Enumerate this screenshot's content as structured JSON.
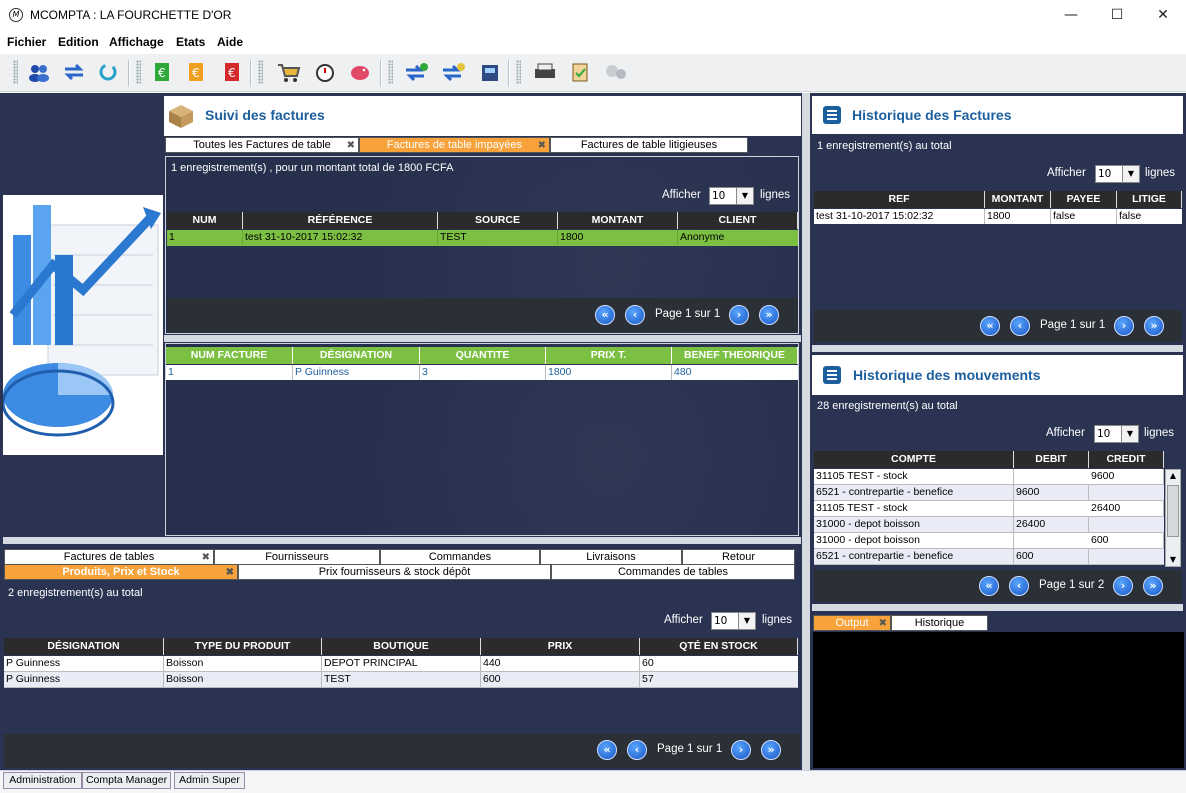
{
  "window": {
    "title": "MCOMPTA : LA FOURCHETTE D'OR",
    "min": "—",
    "max": "☐",
    "close": "✕"
  },
  "menu": [
    "Fichier",
    "Edition",
    "Affichage",
    "Etats",
    "Aide"
  ],
  "suivi": {
    "title": "Suivi des factures",
    "tabs": [
      "Toutes les Factures de table",
      "Factures de table impayées",
      "Factures de table litigieuses"
    ],
    "summary": "1 enregistrement(s) , pour un montant total de 1800 FCFA",
    "afficher": "Afficher",
    "afficher_value": "10",
    "lignes": "lignes",
    "columns": [
      "NUM",
      "RÉFÉRENCE",
      "SOURCE",
      "MONTANT",
      "CLIENT"
    ],
    "rows": [
      [
        "1",
        "test 31-10-2017 15:02:32",
        "TEST",
        "1800",
        "Anonyme"
      ]
    ],
    "page": "Page 1 sur 1"
  },
  "detail": {
    "columns": [
      "NUM FACTURE",
      "DÉSIGNATION",
      "QUANTITE",
      "PRIX T.",
      "BENEF THEORIQUE"
    ],
    "rows": [
      [
        "1",
        "P Guinness",
        "3",
        "1800",
        "480"
      ]
    ]
  },
  "bottom": {
    "tabs_row1": [
      "Factures de tables",
      "Fournisseurs",
      "Commandes",
      "Livraisons",
      "Retour"
    ],
    "tabs_row2": [
      "Produits, Prix et Stock",
      "Prix fournisseurs & stock dépôt",
      "Commandes de tables"
    ],
    "summary": "2 enregistrement(s) au total",
    "afficher": "Afficher",
    "afficher_value": "10",
    "lignes": "lignes",
    "columns": [
      "DÉSIGNATION",
      "TYPE DU PRODUIT",
      "BOUTIQUE",
      "PRIX",
      "QTÉ EN STOCK"
    ],
    "rows": [
      [
        "P Guinness",
        "Boisson",
        "DEPOT PRINCIPAL",
        "440",
        "60"
      ],
      [
        "P Guinness",
        "Boisson",
        "TEST",
        "600",
        "57"
      ]
    ],
    "page": "Page 1 sur 1"
  },
  "historique_factures": {
    "title": "Historique des Factures",
    "summary": "1 enregistrement(s) au total",
    "afficher": "Afficher",
    "afficher_value": "10",
    "lignes": "lignes",
    "columns": [
      "REF",
      "MONTANT",
      "PAYEE",
      "LITIGE"
    ],
    "rows": [
      [
        "test 31-10-2017 15:02:32",
        "1800",
        "false",
        "false"
      ]
    ],
    "page": "Page 1 sur 1"
  },
  "historique_mouvements": {
    "title": "Historique des mouvements",
    "summary": "28 enregistrement(s) au total",
    "afficher": "Afficher",
    "afficher_value": "10",
    "lignes": "lignes",
    "columns": [
      "COMPTE",
      "DEBIT",
      "CREDIT"
    ],
    "rows": [
      [
        "31105 TEST - stock",
        "",
        "9600"
      ],
      [
        "6521 - contrepartie - benefice",
        "9600",
        ""
      ],
      [
        "31105 TEST - stock",
        "",
        "26400"
      ],
      [
        "31000 - depot boisson",
        "26400",
        ""
      ],
      [
        "31000 - depot boisson",
        "",
        "600"
      ],
      [
        "6521 - contrepartie - benefice",
        "600",
        ""
      ]
    ],
    "page": "Page 1 sur 2"
  },
  "output": {
    "tabs": [
      "Output",
      "Historique"
    ]
  },
  "status_tabs": [
    "Administration",
    "Compta Manager",
    "Admin Super"
  ],
  "colors": {
    "navy": "#26304d",
    "green": "#7cc043",
    "orange": "#f7a23a",
    "title_blue": "#1c5f9e"
  }
}
